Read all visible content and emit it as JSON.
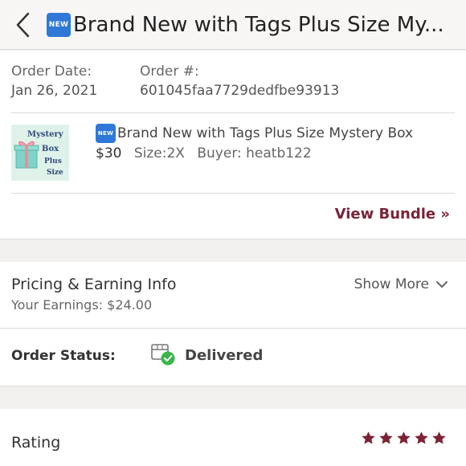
{
  "header": {
    "back_icon": "chevron-left-icon",
    "badge": "NEW",
    "title": "Brand New with Tags Plus Size My..."
  },
  "order": {
    "date_label": "Order Date:",
    "date_value": "Jan 26, 2021",
    "number_label": "Order #:",
    "number_value": "601045faa7729dedfbe93913"
  },
  "item": {
    "thumbnail_text": [
      "Mystery",
      "Box",
      "Plus",
      "Size"
    ],
    "badge": "NEW",
    "title": "Brand New with Tags Plus Size Mystery Box",
    "price": "$30",
    "size": "Size:2X",
    "buyer": "Buyer: heatb122"
  },
  "view_bundle": "View Bundle »",
  "pricing": {
    "title": "Pricing & Earning Info",
    "earnings": "Your Earnings: $24.00",
    "show_more": "Show More"
  },
  "status": {
    "label": "Order Status:",
    "value": "Delivered",
    "icon": "package-delivered-icon"
  },
  "rating": {
    "label": "Rating",
    "stars": 5,
    "max_stars": 5
  },
  "colors": {
    "accent": "#7b2335",
    "badge": "#2f78d8",
    "success": "#3bb54a"
  }
}
